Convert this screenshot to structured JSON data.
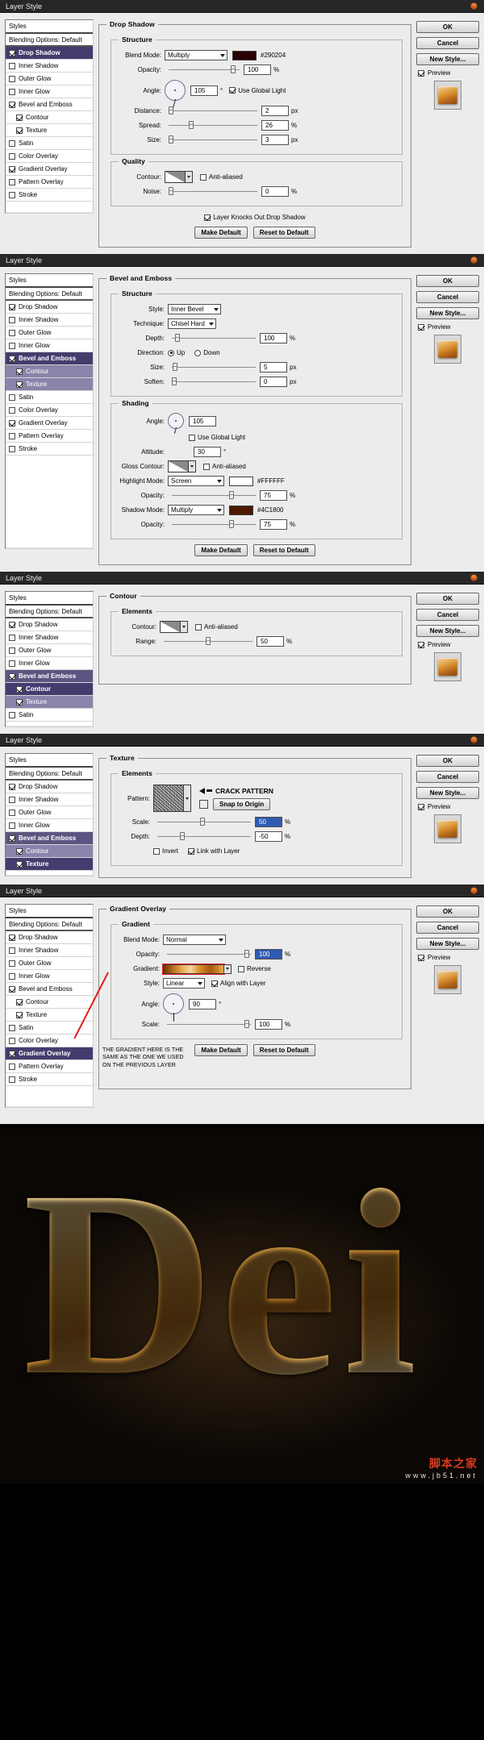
{
  "common": {
    "window_title": "Layer Style",
    "styles_header": "Styles",
    "blending_options": "Blending Options: Default",
    "buttons": {
      "ok": "OK",
      "cancel": "Cancel",
      "new_style": "New Style...",
      "preview": "Preview",
      "make_default": "Make Default",
      "reset_to_default": "Reset to Default"
    },
    "style_list": [
      "Drop Shadow",
      "Inner Shadow",
      "Outer Glow",
      "Inner Glow",
      "Bevel and Emboss",
      "Contour",
      "Texture",
      "Satin",
      "Color Overlay",
      "Gradient Overlay",
      "Pattern Overlay",
      "Stroke"
    ]
  },
  "dialog1": {
    "title": "Layer Style",
    "panel_legend": "Drop Shadow",
    "structure_legend": "Structure",
    "quality_legend": "Quality",
    "blend_mode_label": "Blend Mode:",
    "blend_mode_value": "Multiply",
    "color_hex": "#290204",
    "opacity_label": "Opacity:",
    "opacity_value": "100",
    "opacity_unit": "%",
    "angle_label": "Angle:",
    "angle_value": "105",
    "angle_unit": "°",
    "use_global_light": "Use Global Light",
    "distance_label": "Distance:",
    "distance_value": "2",
    "distance_unit": "px",
    "spread_label": "Spread:",
    "spread_value": "26",
    "spread_unit": "%",
    "size_label": "Size:",
    "size_value": "3",
    "size_unit": "px",
    "contour_label": "Contour:",
    "anti_aliased": "Anti-aliased",
    "noise_label": "Noise:",
    "noise_value": "0",
    "noise_unit": "%",
    "layer_knocks_out": "Layer Knocks Out Drop Shadow",
    "checked_styles": [
      "Drop Shadow",
      "Bevel and Emboss",
      "Contour",
      "Texture",
      "Gradient Overlay"
    ],
    "selected_style": "Drop Shadow"
  },
  "dialog2": {
    "title": "Layer Style",
    "panel_legend": "Bevel and Emboss",
    "structure_legend": "Structure",
    "shading_legend": "Shading",
    "style_label": "Style:",
    "style_value": "Inner Bevel",
    "technique_label": "Technique:",
    "technique_value": "Chisel Hard",
    "depth_label": "Depth:",
    "depth_value": "100",
    "depth_unit": "%",
    "direction_label": "Direction:",
    "direction_up": "Up",
    "direction_down": "Down",
    "size_label": "Size:",
    "size_value": "5",
    "size_unit": "px",
    "soften_label": "Soften:",
    "soften_value": "0",
    "soften_unit": "px",
    "angle_label": "Angle:",
    "angle_value": "105",
    "use_global_light": "Use Global Light",
    "altitude_label": "Altitude:",
    "altitude_value": "30",
    "altitude_unit": "°",
    "gloss_contour_label": "Gloss Contour:",
    "anti_aliased": "Anti-aliased",
    "highlight_mode_label": "Highlight Mode:",
    "highlight_mode_value": "Screen",
    "highlight_hex": "#FFFFFF",
    "highlight_opacity_label": "Opacity:",
    "highlight_opacity_value": "75",
    "shadow_mode_label": "Shadow Mode:",
    "shadow_mode_value": "Multiply",
    "shadow_hex": "#4C1800",
    "shadow_opacity_label": "Opacity:",
    "shadow_opacity_value": "75",
    "percent": "%",
    "selected_style": "Bevel and Emboss"
  },
  "dialog3": {
    "title": "Layer Style",
    "panel_legend": "Contour",
    "elements_legend": "Elements",
    "contour_label": "Contour:",
    "anti_aliased": "Anti-aliased",
    "range_label": "Range:",
    "range_value": "50",
    "range_unit": "%",
    "selected_style": "Contour",
    "style_list": [
      "Drop Shadow",
      "Inner Shadow",
      "Outer Glow",
      "Inner Glow",
      "Bevel and Emboss",
      "Contour",
      "Texture",
      "Satin"
    ]
  },
  "dialog4": {
    "title": "Layer Style",
    "panel_legend": "Texture",
    "elements_legend": "Elements",
    "pattern_label": "Pattern:",
    "pattern_annotation": "CRACK PATTERN",
    "snap_to_origin": "Snap to Origin",
    "scale_label": "Scale:",
    "scale_value": "50",
    "scale_unit": "%",
    "depth_label": "Depth:",
    "depth_value": "-50",
    "depth_unit": "%",
    "invert_label": "Invert",
    "link_with_layer": "Link with Layer",
    "selected_style": "Texture",
    "style_list": [
      "Drop Shadow",
      "Inner Shadow",
      "Outer Glow",
      "Inner Glow",
      "Bevel and Emboss",
      "Contour",
      "Texture"
    ]
  },
  "dialog5": {
    "title": "Layer Style",
    "panel_legend": "Gradient Overlay",
    "gradient_legend": "Gradient",
    "blend_mode_label": "Blend Mode:",
    "blend_mode_value": "Normal",
    "opacity_label": "Opacity:",
    "opacity_value": "100",
    "opacity_unit": "%",
    "gradient_label": "Gradient:",
    "reverse_label": "Reverse",
    "style_label": "Style:",
    "style_value": "Linear",
    "align_with_layer": "Align with Layer",
    "angle_label": "Angle:",
    "angle_value": "90",
    "angle_unit": "°",
    "scale_label": "Scale:",
    "scale_value": "100",
    "scale_unit": "%",
    "annotation": "THE GRADIENT HERE IS THE\nSAME AS THE ONE WE USED\nON THE PREVIOUS LAYER",
    "selected_style": "Gradient Overlay"
  },
  "artwork": {
    "text": "Dei",
    "watermark_top": "脚本之家",
    "watermark_bottom": "www.jb51.net"
  }
}
